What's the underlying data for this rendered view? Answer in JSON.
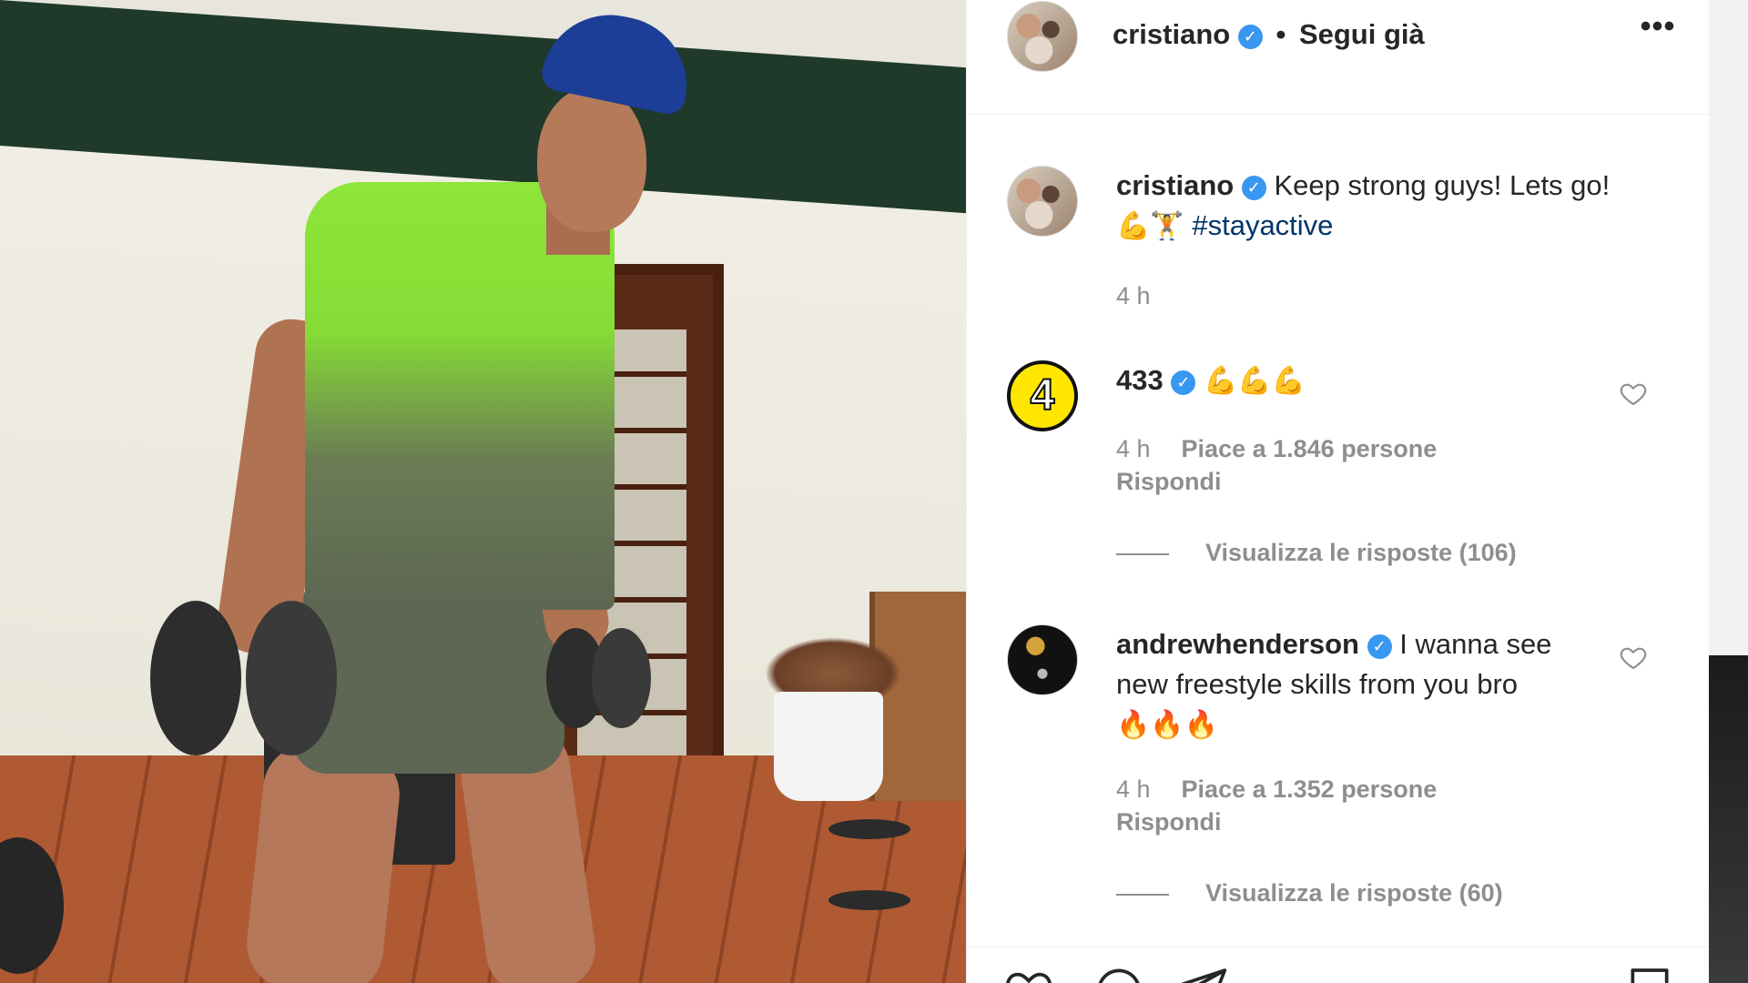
{
  "post": {
    "author": "cristiano",
    "follow_status": "Segui già",
    "separator": "•",
    "more_label": "•••"
  },
  "caption": {
    "author": "cristiano",
    "text": "Keep strong guys! Lets go!",
    "emojis": "💪🏋",
    "hashtag": "#stayactive",
    "time": "4 h"
  },
  "comments": [
    {
      "author": "433",
      "emojis": "💪💪💪",
      "time": "4 h",
      "likes": "Piace a 1.846 persone",
      "reply": "Rispondi",
      "view_replies": "Visualizza le risposte (106)",
      "avatar_text": "4"
    },
    {
      "author": "andrewhenderson",
      "text_line1": "I wanna see",
      "text_line2": "new freestyle skills from you bro",
      "emojis": "🔥🔥🔥",
      "time": "4 h",
      "likes": "Piace a 1.352 persone",
      "reply": "Rispondi",
      "view_replies": "Visualizza le risposte (60)"
    }
  ],
  "icons": {
    "verified": "verified-badge-icon",
    "heart": "heart-icon",
    "comment": "comment-icon",
    "share": "share-icon",
    "save": "bookmark-icon"
  },
  "colors": {
    "verified": "#3897f0",
    "text": "#262626",
    "muted": "#8e8e8e",
    "hashtag": "#003569"
  }
}
